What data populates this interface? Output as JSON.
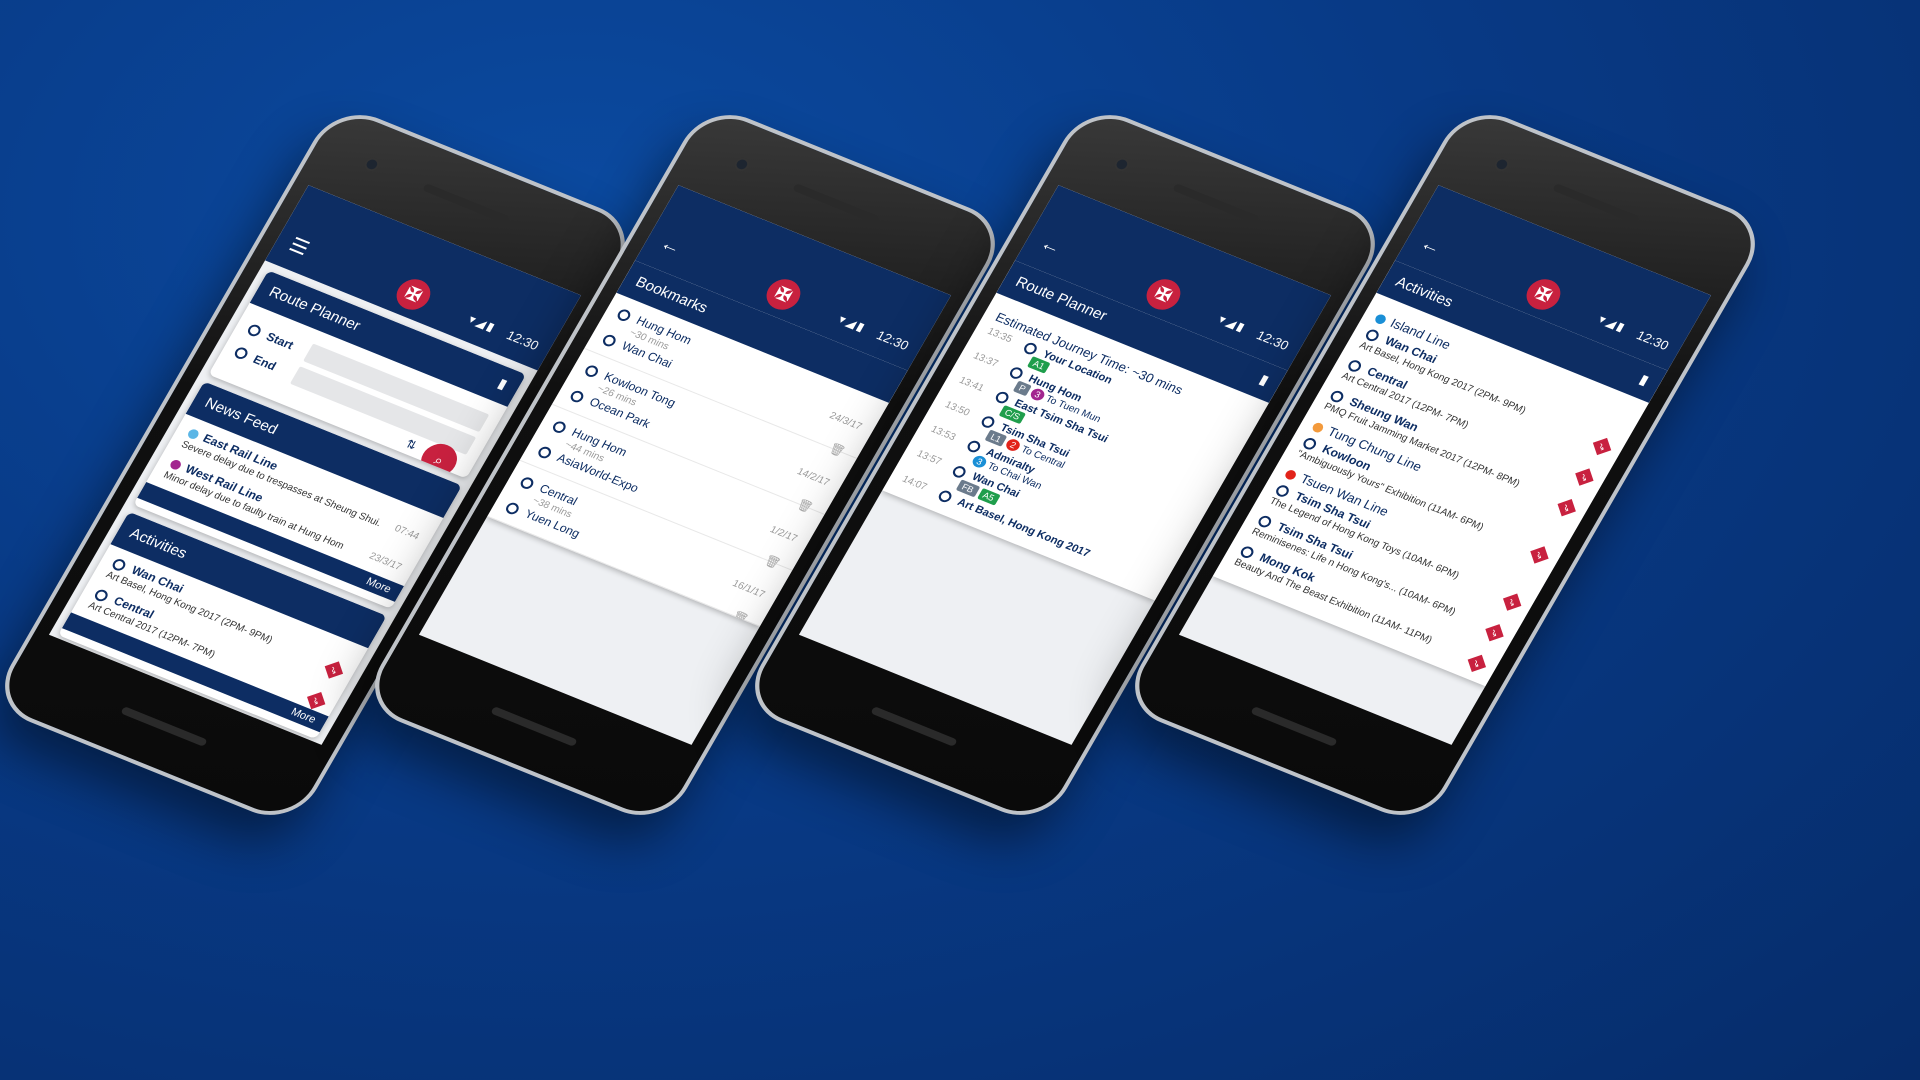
{
  "status": {
    "time": "12:30",
    "icons": "▾◢▮"
  },
  "brand": {
    "logo_glyph": "✠",
    "accent": "#c8213f",
    "navy": "#0d2d63"
  },
  "phone1": {
    "route_planner": {
      "title": "Route Planner",
      "start_label": "Start",
      "end_label": "End"
    },
    "news": {
      "title": "News Feed",
      "items": [
        {
          "line": "East Rail Line",
          "color": "#5bb6e6",
          "text": "Severe delay due to trespasses at Sheung Shui.",
          "time": "07:44"
        },
        {
          "line": "West Rail Line",
          "color": "#a2268f",
          "text": "Minor delay due to faulty train at Hung Hom",
          "time": "23/3/17"
        }
      ],
      "more": "More"
    },
    "activities": {
      "title": "Activities",
      "items": [
        {
          "place": "Wan Chai",
          "event": "Art Basel, Hong Kong 2017 (2PM- 9PM)"
        },
        {
          "place": "Central",
          "event": "Art Central 2017 (12PM- 7PM)"
        }
      ],
      "more": "More"
    }
  },
  "phone2": {
    "title": "Bookmarks",
    "items": [
      {
        "from": "Hung Hom",
        "to": "Wan Chai",
        "duration": "~30 mins",
        "date": "24/3/17"
      },
      {
        "from": "Kowloon Tong",
        "to": "Ocean Park",
        "duration": "~26 mins",
        "date": "14/2/17"
      },
      {
        "from": "Hung Hom",
        "to": "AsiaWorld-Expo",
        "duration": "~44 mins",
        "date": "1/2/17"
      },
      {
        "from": "Central",
        "to": "Yuen Long",
        "duration": "~38 mins",
        "date": "16/1/17"
      }
    ]
  },
  "phone3": {
    "title": "Route Planner",
    "estimate": "Estimated Journey Time: ~30 mins",
    "steps": [
      {
        "time": "13:35",
        "name": "Your Location",
        "detail": "A1"
      },
      {
        "time": "13:37",
        "name": "Hung Hom",
        "detail": "P",
        "direction": "To Tuen Mun",
        "num": "3"
      },
      {
        "time": "13:41",
        "name": "East Tsim Sha Tsui",
        "detail": "C/S"
      },
      {
        "time": "13:50",
        "name": "Tsim Sha Tsui",
        "detail": "L1",
        "direction": "To Central",
        "num": "2"
      },
      {
        "time": "13:53",
        "name": "Admiralty",
        "direction": "To Chai Wan",
        "num": "3"
      },
      {
        "time": "13:57",
        "name": "Wan Chai",
        "detail": "FB",
        "detail2": "A5"
      },
      {
        "time": "14:07",
        "name": "Art Basel, Hong Kong 2017"
      }
    ]
  },
  "phone4": {
    "title": "Activities",
    "groups": [
      {
        "line": "Island Line",
        "color": "#1a8fd6",
        "items": [
          {
            "place": "Wan Chai",
            "event": "Art Basel, Hong Kong 2017 (2PM- 9PM)"
          },
          {
            "place": "Central",
            "event": "Art Central 2017 (12PM- 7PM)"
          },
          {
            "place": "Sheung Wan",
            "event": "PMQ Fruit Jamming Market 2017 (12PM- 8PM)"
          }
        ]
      },
      {
        "line": "Tung Chung Line",
        "color": "#f39a3c",
        "items": [
          {
            "place": "Kowloon",
            "event": "\"Ambiguously Yours\" Exhibition (11AM- 6PM)"
          }
        ]
      },
      {
        "line": "Tsuen Wan Line",
        "color": "#e2231a",
        "items": [
          {
            "place": "Tsim Sha Tsui",
            "event": "The Legend of Hong Kong Toys (10AM- 6PM)"
          },
          {
            "place": "Tsim Sha Tsui",
            "event": "Reminisenes: Life n Hong Kong's... (10AM- 6PM)"
          },
          {
            "place": "Mong Kok",
            "event": "Beauty And The Beast Exhibition (11AM- 11PM)"
          }
        ]
      }
    ]
  }
}
